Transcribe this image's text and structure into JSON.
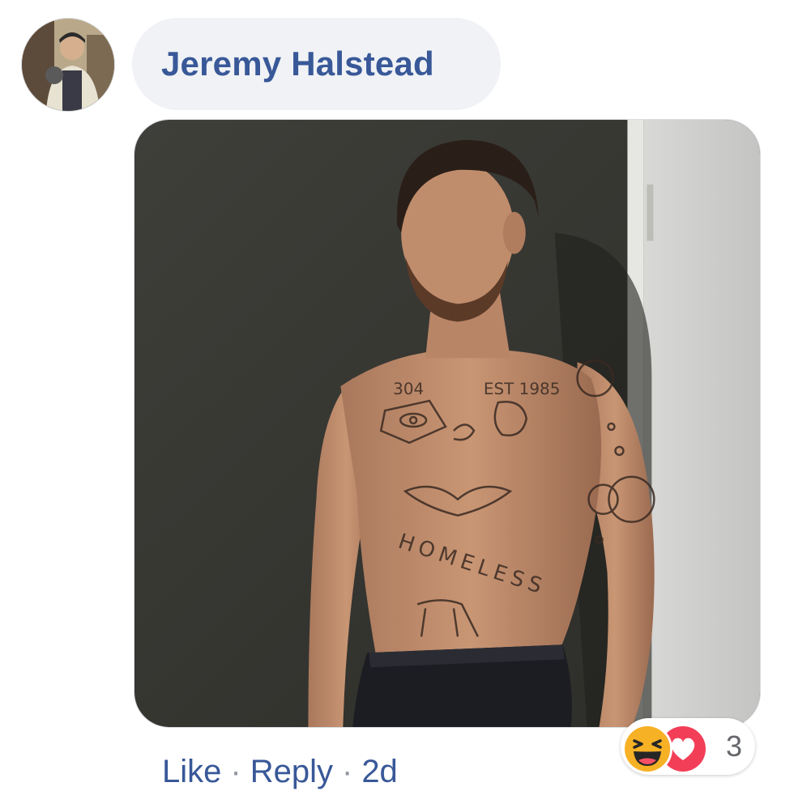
{
  "comment": {
    "author": "Jeremy Halstead",
    "avatar_icon": "profile-photo",
    "attachment": {
      "type": "photo",
      "drawn_text": [
        "304",
        "EST 1985",
        "HOMELESS"
      ]
    },
    "actions": {
      "like": "Like",
      "reply": "Reply",
      "separator": "·",
      "time": "2d"
    },
    "reactions": {
      "icons": [
        "haha-reaction-icon",
        "love-reaction-icon"
      ],
      "count": "3",
      "colors": {
        "haha": "#f7b125",
        "love": "#f33e58"
      }
    }
  },
  "colors": {
    "link": "#385898",
    "bubble": "#f0f2f5",
    "separator": "#90949c"
  }
}
